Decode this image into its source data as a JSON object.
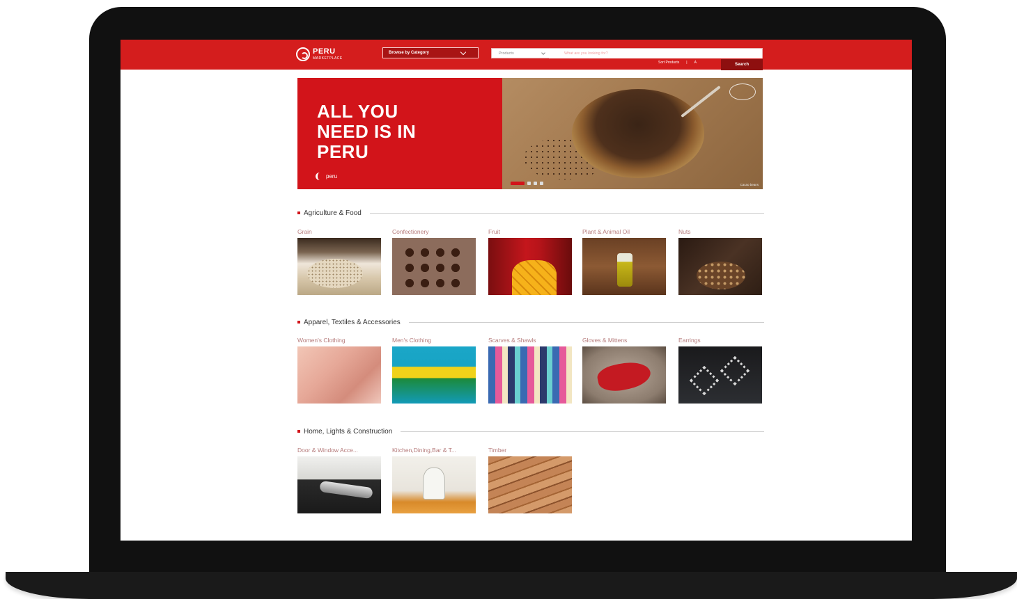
{
  "header": {
    "logo_line1": "PERU",
    "logo_line2": "MARKETPLACE",
    "browse_label": "Browse by Category",
    "search_select": "Products",
    "search_placeholder": "What are you looking for?",
    "sublinks": [
      "Sort Products",
      "|",
      "A"
    ],
    "search_button": "Search"
  },
  "hero": {
    "headline": "ALL YOU\nNEED IS IN\nPERU",
    "brand": "peru",
    "caption": "Cacao beans",
    "slides": 4,
    "active_slide": 1
  },
  "sections": [
    {
      "title": "Agriculture & Food",
      "items": [
        {
          "label": "Grain",
          "image": "grain-photo"
        },
        {
          "label": "Confectionery",
          "image": "chocolate-photo"
        },
        {
          "label": "Fruit",
          "image": "mango-photo"
        },
        {
          "label": "Plant & Animal Oil",
          "image": "oil-photo"
        },
        {
          "label": "Nuts",
          "image": "nuts-photo"
        }
      ]
    },
    {
      "title": "Apparel, Textiles & Accessories",
      "items": [
        {
          "label": "Women's Clothing",
          "image": "womens-clothing-photo"
        },
        {
          "label": "Men's Clothing",
          "image": "mens-clothing-photo"
        },
        {
          "label": "Scarves & Shawls",
          "image": "scarves-photo"
        },
        {
          "label": "Gloves & Mittens",
          "image": "gloves-photo"
        },
        {
          "label": "Earrings",
          "image": "earrings-photo"
        }
      ]
    },
    {
      "title": "Home, Lights & Construction",
      "items": [
        {
          "label": "Door & Window Acce...",
          "image": "door-hardware-photo"
        },
        {
          "label": "Kitchen,Dining,Bar & T...",
          "image": "kitchen-photo"
        },
        {
          "label": "Timber",
          "image": "timber-photo"
        }
      ]
    }
  ],
  "colors": {
    "brand_red": "#d41d1d",
    "dark_red": "#8e0f0f",
    "frame": "#111111"
  }
}
